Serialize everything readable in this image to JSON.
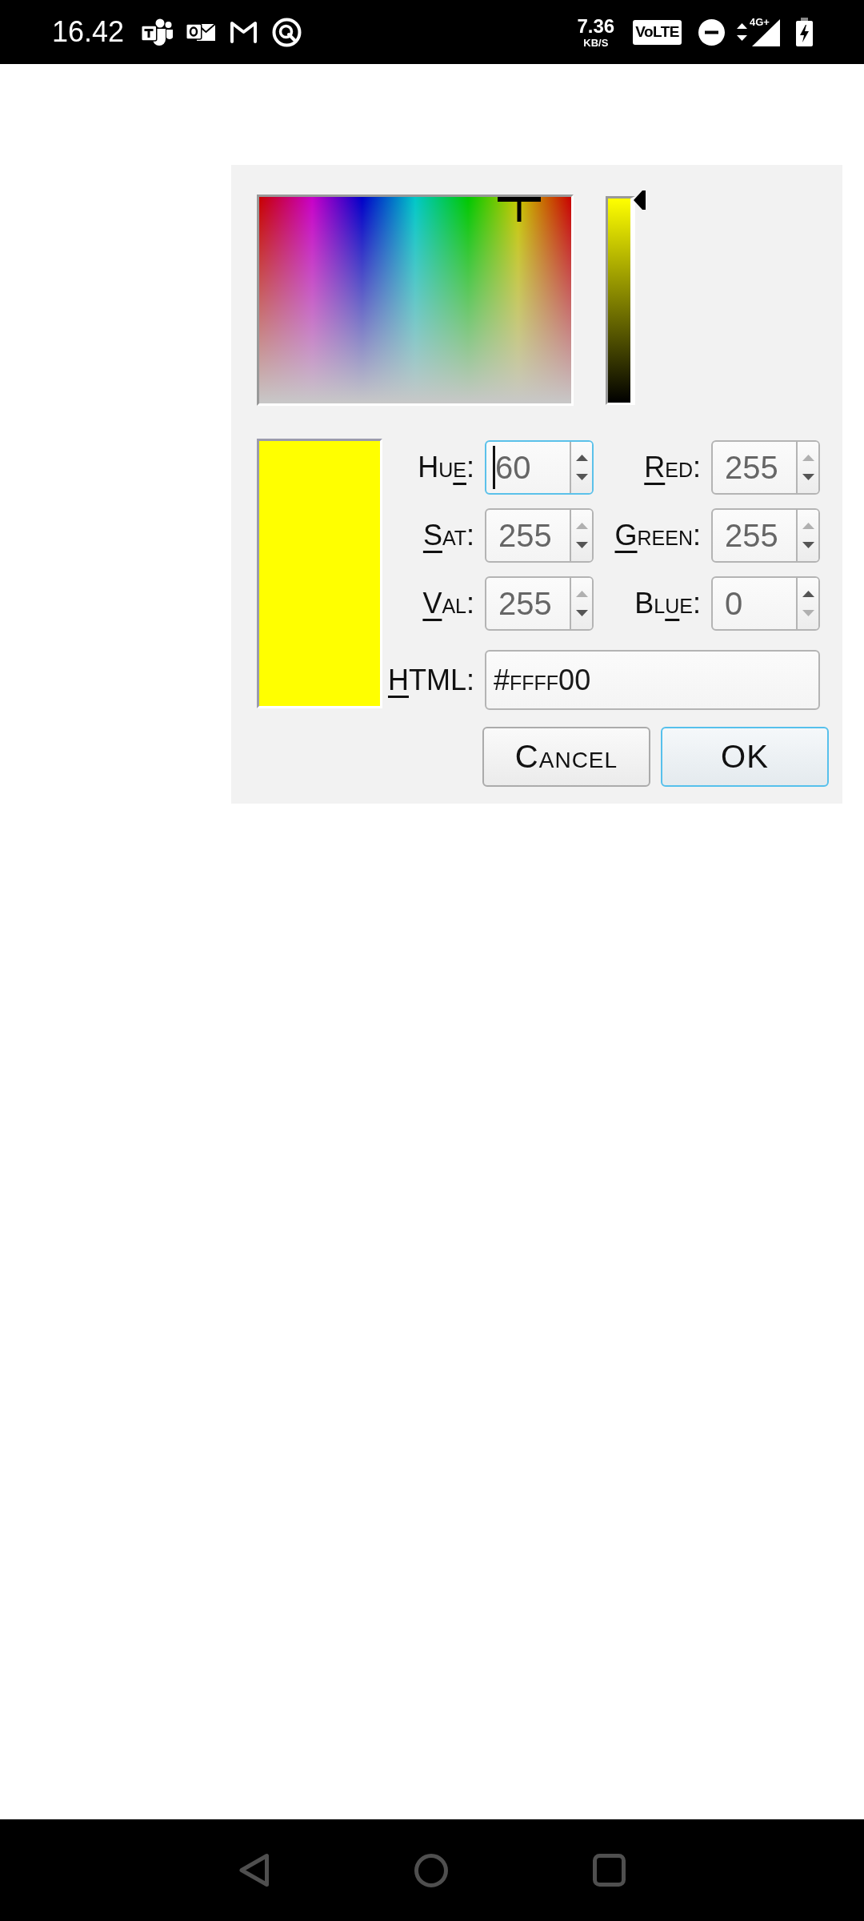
{
  "status_bar": {
    "time": "16.42",
    "speed": "7.36",
    "speed_unit": "KB/S",
    "volte": "VoLTE",
    "network": "4G+"
  },
  "color_picker": {
    "value_slider": {
      "level": 1
    },
    "preview": {
      "color": "#ffff00"
    },
    "fields": [
      {
        "label": {
          "before": "Hu",
          "underlined": "e",
          "after": ":"
        },
        "value": "60",
        "focused": true,
        "up_enabled": true,
        "down_enabled": true
      },
      {
        "label": {
          "underlined": "R",
          "after": "ed:"
        },
        "value": "255",
        "focused": false,
        "up_enabled": false,
        "down_enabled": true
      },
      {
        "label": {
          "underlined": "S",
          "after": "at:"
        },
        "value": "255",
        "focused": false,
        "up_enabled": false,
        "down_enabled": true
      },
      {
        "label": {
          "underlined": "G",
          "after": "reen:"
        },
        "value": "255",
        "focused": false,
        "up_enabled": false,
        "down_enabled": true
      },
      {
        "label": {
          "underlined": "V",
          "after": "al:"
        },
        "value": "255",
        "focused": false,
        "up_enabled": false,
        "down_enabled": true
      },
      {
        "label": {
          "before": "Bl",
          "underlined": "u",
          "after": "e:"
        },
        "value": "0",
        "focused": false,
        "up_enabled": true,
        "down_enabled": false
      }
    ],
    "html_field": {
      "label": {
        "underlined": "H",
        "after": "TML:"
      },
      "value": "#ffff00",
      "focused": false
    },
    "buttons": [
      {
        "label": "Cancel",
        "default": false
      },
      {
        "label": "OK",
        "default": true
      }
    ]
  }
}
